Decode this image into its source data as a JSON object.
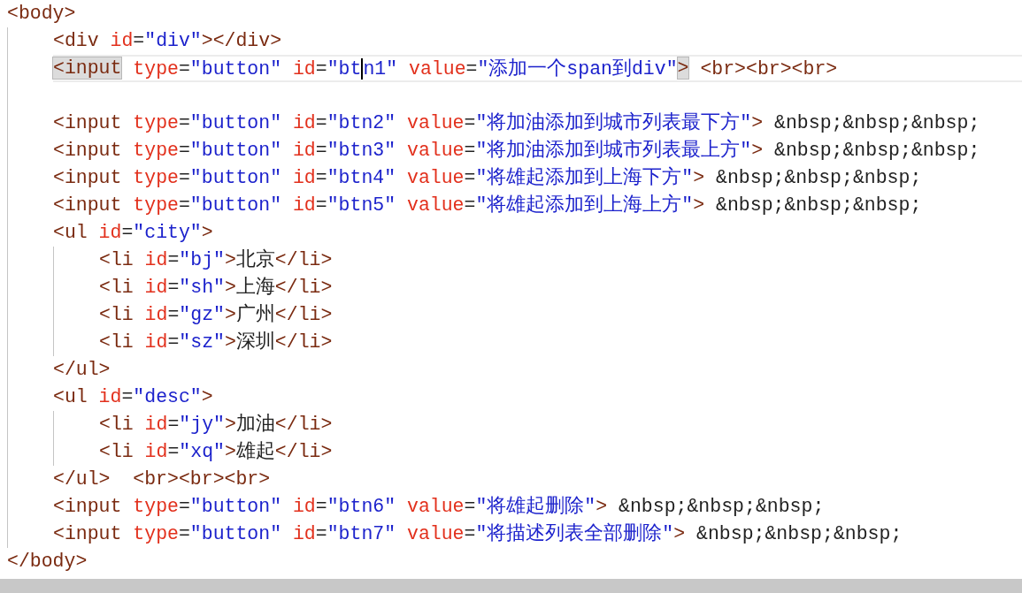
{
  "lines": [
    {
      "kind": "code",
      "tokens": [
        {
          "kind": "tag",
          "text": "<body>"
        }
      ],
      "children": [
        {
          "kind": "code",
          "tokens": [
            {
              "kind": "tag",
              "text": "<div"
            },
            {
              "kind": "attr",
              "text": " id"
            },
            {
              "kind": "plain",
              "text": "="
            },
            {
              "kind": "value",
              "text": "\"div\""
            },
            {
              "kind": "tag",
              "text": "></div>"
            }
          ]
        },
        {
          "kind": "code",
          "current": true,
          "tokens": [
            {
              "kind": "tag",
              "text": "<input",
              "matched": true
            },
            {
              "kind": "attr",
              "text": " type"
            },
            {
              "kind": "plain",
              "text": "="
            },
            {
              "kind": "value",
              "text": "\"button\""
            },
            {
              "kind": "attr",
              "text": " id"
            },
            {
              "kind": "plain",
              "text": "="
            },
            {
              "kind": "value",
              "text": "\"bt",
              "caret_after": true
            },
            {
              "kind": "value",
              "text": "n1\""
            },
            {
              "kind": "attr",
              "text": " value"
            },
            {
              "kind": "plain",
              "text": "="
            },
            {
              "kind": "value",
              "text": "\"添加一个span到div\""
            },
            {
              "kind": "tag",
              "text": ">",
              "matched": true
            },
            {
              "kind": "tag",
              "text": " <br><br><br>"
            }
          ]
        },
        {
          "kind": "blank"
        },
        {
          "kind": "code",
          "tokens": [
            {
              "kind": "tag",
              "text": "<input"
            },
            {
              "kind": "attr",
              "text": " type"
            },
            {
              "kind": "plain",
              "text": "="
            },
            {
              "kind": "value",
              "text": "\"button\""
            },
            {
              "kind": "attr",
              "text": " id"
            },
            {
              "kind": "plain",
              "text": "="
            },
            {
              "kind": "value",
              "text": "\"btn2\""
            },
            {
              "kind": "attr",
              "text": " value"
            },
            {
              "kind": "plain",
              "text": "="
            },
            {
              "kind": "value",
              "text": "\"将加油添加到城市列表最下方\""
            },
            {
              "kind": "tag",
              "text": ">"
            },
            {
              "kind": "plain",
              "text": " &nbsp;&nbsp;&nbsp;"
            }
          ]
        },
        {
          "kind": "code",
          "tokens": [
            {
              "kind": "tag",
              "text": "<input"
            },
            {
              "kind": "attr",
              "text": " type"
            },
            {
              "kind": "plain",
              "text": "="
            },
            {
              "kind": "value",
              "text": "\"button\""
            },
            {
              "kind": "attr",
              "text": " id"
            },
            {
              "kind": "plain",
              "text": "="
            },
            {
              "kind": "value",
              "text": "\"btn3\""
            },
            {
              "kind": "attr",
              "text": " value"
            },
            {
              "kind": "plain",
              "text": "="
            },
            {
              "kind": "value",
              "text": "\"将加油添加到城市列表最上方\""
            },
            {
              "kind": "tag",
              "text": ">"
            },
            {
              "kind": "plain",
              "text": " &nbsp;&nbsp;&nbsp;"
            }
          ]
        },
        {
          "kind": "code",
          "tokens": [
            {
              "kind": "tag",
              "text": "<input"
            },
            {
              "kind": "attr",
              "text": " type"
            },
            {
              "kind": "plain",
              "text": "="
            },
            {
              "kind": "value",
              "text": "\"button\""
            },
            {
              "kind": "attr",
              "text": " id"
            },
            {
              "kind": "plain",
              "text": "="
            },
            {
              "kind": "value",
              "text": "\"btn4\""
            },
            {
              "kind": "attr",
              "text": " value"
            },
            {
              "kind": "plain",
              "text": "="
            },
            {
              "kind": "value",
              "text": "\"将雄起添加到上海下方\""
            },
            {
              "kind": "tag",
              "text": ">"
            },
            {
              "kind": "plain",
              "text": " &nbsp;&nbsp;&nbsp;"
            }
          ]
        },
        {
          "kind": "code",
          "tokens": [
            {
              "kind": "tag",
              "text": "<input"
            },
            {
              "kind": "attr",
              "text": " type"
            },
            {
              "kind": "plain",
              "text": "="
            },
            {
              "kind": "value",
              "text": "\"button\""
            },
            {
              "kind": "attr",
              "text": " id"
            },
            {
              "kind": "plain",
              "text": "="
            },
            {
              "kind": "value",
              "text": "\"btn5\""
            },
            {
              "kind": "attr",
              "text": " value"
            },
            {
              "kind": "plain",
              "text": "="
            },
            {
              "kind": "value",
              "text": "\"将雄起添加到上海上方\""
            },
            {
              "kind": "tag",
              "text": ">"
            },
            {
              "kind": "plain",
              "text": " &nbsp;&nbsp;&nbsp;"
            }
          ]
        },
        {
          "kind": "code",
          "tokens": [
            {
              "kind": "tag",
              "text": "<ul"
            },
            {
              "kind": "attr",
              "text": " id"
            },
            {
              "kind": "plain",
              "text": "="
            },
            {
              "kind": "value",
              "text": "\"city\""
            },
            {
              "kind": "tag",
              "text": ">"
            }
          ],
          "children": [
            {
              "kind": "code",
              "tokens": [
                {
                  "kind": "tag",
                  "text": "<li"
                },
                {
                  "kind": "attr",
                  "text": " id"
                },
                {
                  "kind": "plain",
                  "text": "="
                },
                {
                  "kind": "value",
                  "text": "\"bj\""
                },
                {
                  "kind": "tag",
                  "text": ">"
                },
                {
                  "kind": "plain",
                  "text": "北京"
                },
                {
                  "kind": "tag",
                  "text": "</li>"
                }
              ]
            },
            {
              "kind": "code",
              "tokens": [
                {
                  "kind": "tag",
                  "text": "<li"
                },
                {
                  "kind": "attr",
                  "text": " id"
                },
                {
                  "kind": "plain",
                  "text": "="
                },
                {
                  "kind": "value",
                  "text": "\"sh\""
                },
                {
                  "kind": "tag",
                  "text": ">"
                },
                {
                  "kind": "plain",
                  "text": "上海"
                },
                {
                  "kind": "tag",
                  "text": "</li>"
                }
              ]
            },
            {
              "kind": "code",
              "tokens": [
                {
                  "kind": "tag",
                  "text": "<li"
                },
                {
                  "kind": "attr",
                  "text": " id"
                },
                {
                  "kind": "plain",
                  "text": "="
                },
                {
                  "kind": "value",
                  "text": "\"gz\""
                },
                {
                  "kind": "tag",
                  "text": ">"
                },
                {
                  "kind": "plain",
                  "text": "广州"
                },
                {
                  "kind": "tag",
                  "text": "</li>"
                }
              ]
            },
            {
              "kind": "code",
              "tokens": [
                {
                  "kind": "tag",
                  "text": "<li"
                },
                {
                  "kind": "attr",
                  "text": " id"
                },
                {
                  "kind": "plain",
                  "text": "="
                },
                {
                  "kind": "value",
                  "text": "\"sz\""
                },
                {
                  "kind": "tag",
                  "text": ">"
                },
                {
                  "kind": "plain",
                  "text": "深圳"
                },
                {
                  "kind": "tag",
                  "text": "</li>"
                }
              ]
            }
          ]
        },
        {
          "kind": "code",
          "tokens": [
            {
              "kind": "tag",
              "text": "</ul>"
            }
          ]
        },
        {
          "kind": "code",
          "tokens": [
            {
              "kind": "tag",
              "text": "<ul"
            },
            {
              "kind": "attr",
              "text": " id"
            },
            {
              "kind": "plain",
              "text": "="
            },
            {
              "kind": "value",
              "text": "\"desc\""
            },
            {
              "kind": "tag",
              "text": ">"
            }
          ],
          "children": [
            {
              "kind": "code",
              "tokens": [
                {
                  "kind": "tag",
                  "text": "<li"
                },
                {
                  "kind": "attr",
                  "text": " id"
                },
                {
                  "kind": "plain",
                  "text": "="
                },
                {
                  "kind": "value",
                  "text": "\"jy\""
                },
                {
                  "kind": "tag",
                  "text": ">"
                },
                {
                  "kind": "plain",
                  "text": "加油"
                },
                {
                  "kind": "tag",
                  "text": "</li>"
                }
              ]
            },
            {
              "kind": "code",
              "tokens": [
                {
                  "kind": "tag",
                  "text": "<li"
                },
                {
                  "kind": "attr",
                  "text": " id"
                },
                {
                  "kind": "plain",
                  "text": "="
                },
                {
                  "kind": "value",
                  "text": "\"xq\""
                },
                {
                  "kind": "tag",
                  "text": ">"
                },
                {
                  "kind": "plain",
                  "text": "雄起"
                },
                {
                  "kind": "tag",
                  "text": "</li>"
                }
              ]
            }
          ]
        },
        {
          "kind": "code",
          "tokens": [
            {
              "kind": "tag",
              "text": "</ul>"
            },
            {
              "kind": "tag",
              "text": "  <br><br><br>"
            }
          ]
        },
        {
          "kind": "code",
          "tokens": [
            {
              "kind": "tag",
              "text": "<input"
            },
            {
              "kind": "attr",
              "text": " type"
            },
            {
              "kind": "plain",
              "text": "="
            },
            {
              "kind": "value",
              "text": "\"button\""
            },
            {
              "kind": "attr",
              "text": " id"
            },
            {
              "kind": "plain",
              "text": "="
            },
            {
              "kind": "value",
              "text": "\"btn6\""
            },
            {
              "kind": "attr",
              "text": " value"
            },
            {
              "kind": "plain",
              "text": "="
            },
            {
              "kind": "value",
              "text": "\"将雄起删除\""
            },
            {
              "kind": "tag",
              "text": ">"
            },
            {
              "kind": "plain",
              "text": " &nbsp;&nbsp;&nbsp;"
            }
          ]
        },
        {
          "kind": "code",
          "tokens": [
            {
              "kind": "tag",
              "text": "<input"
            },
            {
              "kind": "attr",
              "text": " type"
            },
            {
              "kind": "plain",
              "text": "="
            },
            {
              "kind": "value",
              "text": "\"button\""
            },
            {
              "kind": "attr",
              "text": " id"
            },
            {
              "kind": "plain",
              "text": "="
            },
            {
              "kind": "value",
              "text": "\"btn7\""
            },
            {
              "kind": "attr",
              "text": " value"
            },
            {
              "kind": "plain",
              "text": "="
            },
            {
              "kind": "value",
              "text": "\"将描述列表全部删除\""
            },
            {
              "kind": "tag",
              "text": ">"
            },
            {
              "kind": "plain",
              "text": " &nbsp;&nbsp;&nbsp;"
            }
          ]
        }
      ]
    },
    {
      "kind": "code",
      "tokens": [
        {
          "kind": "tag",
          "text": "</body>"
        }
      ]
    }
  ]
}
